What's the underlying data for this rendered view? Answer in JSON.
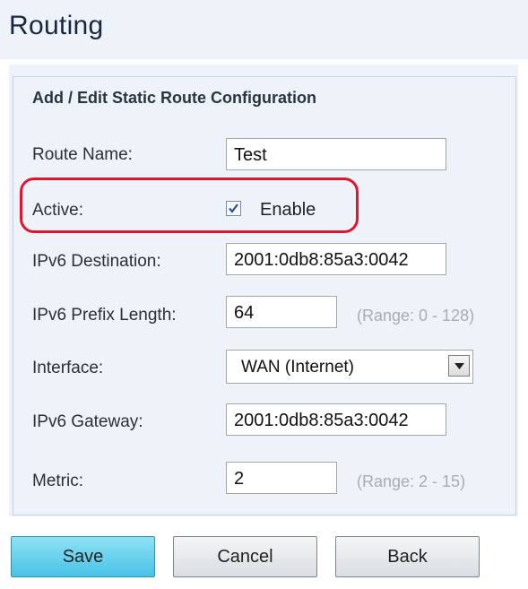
{
  "page": {
    "title": "Routing"
  },
  "form": {
    "section_title": "Add / Edit Static Route Configuration",
    "route_name": {
      "label": "Route Name:",
      "value": "Test"
    },
    "active": {
      "label": "Active:",
      "checked": true,
      "checkbox_label": "Enable"
    },
    "ipv6_destination": {
      "label": "IPv6 Destination:",
      "value": "2001:0db8:85a3:0042"
    },
    "ipv6_prefix_length": {
      "label": "IPv6 Prefix Length:",
      "value": "64",
      "range_hint": "(Range: 0 - 128)"
    },
    "interface": {
      "label": "Interface:",
      "selected": "WAN (Internet)"
    },
    "ipv6_gateway": {
      "label": "IPv6 Gateway:",
      "value": "2001:0db8:85a3:0042"
    },
    "metric": {
      "label": "Metric:",
      "value": "2",
      "range_hint": "(Range: 2 - 15)"
    }
  },
  "buttons": {
    "save": "Save",
    "cancel": "Cancel",
    "back": "Back"
  },
  "colors": {
    "highlight": "#e0152e",
    "primary_button": "#48c2e6",
    "panel_bg": "#eef3f9"
  }
}
